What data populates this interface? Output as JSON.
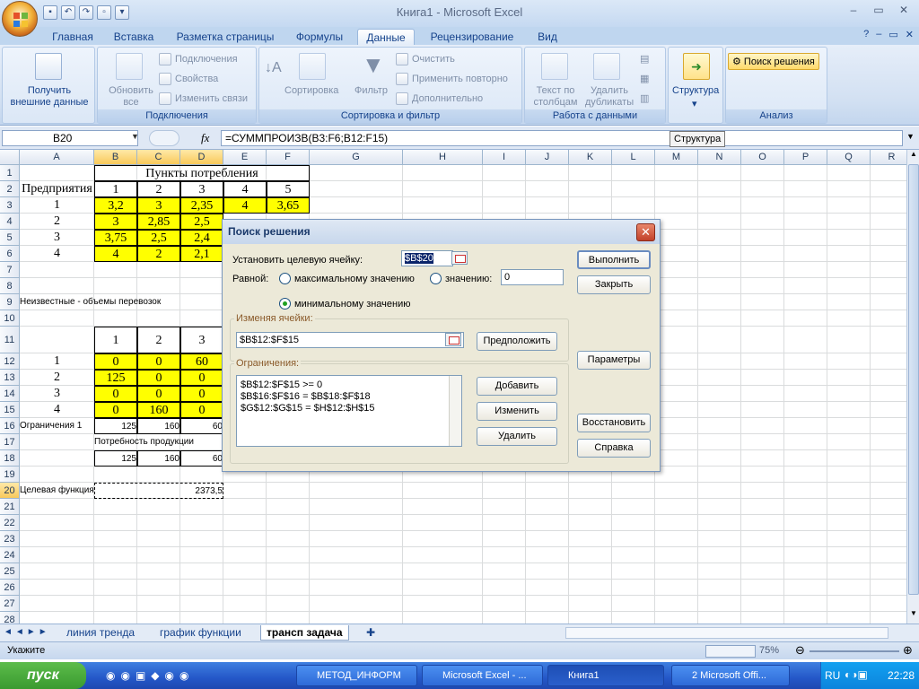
{
  "window": {
    "title": "Книга1 - Microsoft Excel"
  },
  "ribbon_tabs": [
    "Главная",
    "Вставка",
    "Разметка страницы",
    "Формулы",
    "Данные",
    "Рецензирование",
    "Вид"
  ],
  "active_tab": "Данные",
  "ribbon": {
    "get_external_data": "Получить внешние данные",
    "refresh_all": "Обновить все",
    "connections": "Подключения",
    "properties": "Свойства",
    "edit_links": "Изменить связи",
    "group_connections": "Подключения",
    "sort": "Сортировка",
    "filter": "Фильтр",
    "clear": "Очистить",
    "reapply": "Применить повторно",
    "advanced": "Дополнительно",
    "group_sort_filter": "Сортировка и фильтр",
    "text_to_columns": "Текст по столбцам",
    "remove_duplicates": "Удалить дубликаты",
    "group_data_tools": "Работа с данными",
    "outline": "Структура",
    "solver": "Поиск решения",
    "group_analysis": "Анализ"
  },
  "formula_bar": {
    "cell_ref": "B20",
    "fx": "fx",
    "formula": "=СУММПРОИЗВ(B3:F6;B12:F15)"
  },
  "tooltip": "Структура",
  "grid": {
    "columns": [
      "A",
      "B",
      "C",
      "D",
      "E",
      "F",
      "G",
      "H",
      "I",
      "J",
      "K",
      "L",
      "M",
      "N",
      "O",
      "P",
      "Q",
      "R"
    ],
    "rows": [
      "1",
      "2",
      "3",
      "4",
      "5",
      "6",
      "7",
      "8",
      "9",
      "10",
      "11",
      "12",
      "13",
      "14",
      "15",
      "16",
      "17",
      "18",
      "19",
      "20",
      "21",
      "22",
      "23",
      "24",
      "25",
      "26",
      "27",
      "28"
    ],
    "header_consumption": "Пункты потребления",
    "header_enterprises": "Предприятия",
    "cons_cols": [
      "1",
      "2",
      "3",
      "4",
      "5"
    ],
    "row_labels_1": [
      "1",
      "2",
      "3",
      "4"
    ],
    "costs": [
      [
        "3,2",
        "3",
        "2,35",
        "4",
        "3,65"
      ],
      [
        "3",
        "2,85",
        "2,5"
      ],
      [
        "3,75",
        "2,5",
        "2,4"
      ],
      [
        "4",
        "2",
        "2,1"
      ]
    ],
    "unknowns_label": "Неизвестные - объемы перевозок",
    "unknown_cols": [
      "1",
      "2",
      "3"
    ],
    "row_labels_2": [
      "1",
      "2",
      "3",
      "4"
    ],
    "volumes": [
      [
        "0",
        "0",
        "60"
      ],
      [
        "125",
        "0",
        "0"
      ],
      [
        "0",
        "0",
        "0"
      ],
      [
        "0",
        "160",
        "0"
      ]
    ],
    "restr_label": "Ограничения 1",
    "restr_vals": [
      "125",
      "160",
      "60"
    ],
    "demand_label": "Потребность продукции",
    "demand_vals": [
      "125",
      "160",
      "60"
    ],
    "target_label": "Целевая функция",
    "target_val": "2373,5"
  },
  "sheet_tabs": [
    "линия тренда",
    "график функции",
    "трансп задача"
  ],
  "active_sheet": "трансп задача",
  "status": {
    "ready": "Укажите",
    "zoom": "75%"
  },
  "taskbar": {
    "start": "пуск",
    "items": [
      "МЕТОД_ИНФОРМ",
      "Microsoft Excel - ...",
      "Книга1",
      "2 Microsoft Offi..."
    ],
    "lang": "RU",
    "clock": "22:28"
  },
  "dialog": {
    "title": "Поиск решения",
    "set_target_label": "Установить целевую ячейку:",
    "target_cell": "$B$20",
    "equal_label": "Равной:",
    "max_label": "максимальному значению",
    "value_label": "значению:",
    "value": "0",
    "min_label": "минимальному значению",
    "changing_label": "Изменяя ячейки:",
    "changing_cells": "$B$12:$F$15",
    "guess": "Предположить",
    "constraints_label": "Ограничения:",
    "constraints": [
      "$B$12:$F$15 >= 0",
      "$B$16:$F$16 = $B$18:$F$18",
      "$G$12:$G$15 = $H$12:$H$15"
    ],
    "add": "Добавить",
    "change": "Изменить",
    "delete": "Удалить",
    "solve": "Выполнить",
    "close": "Закрыть",
    "options": "Параметры",
    "reset": "Восстановить",
    "help": "Справка"
  }
}
